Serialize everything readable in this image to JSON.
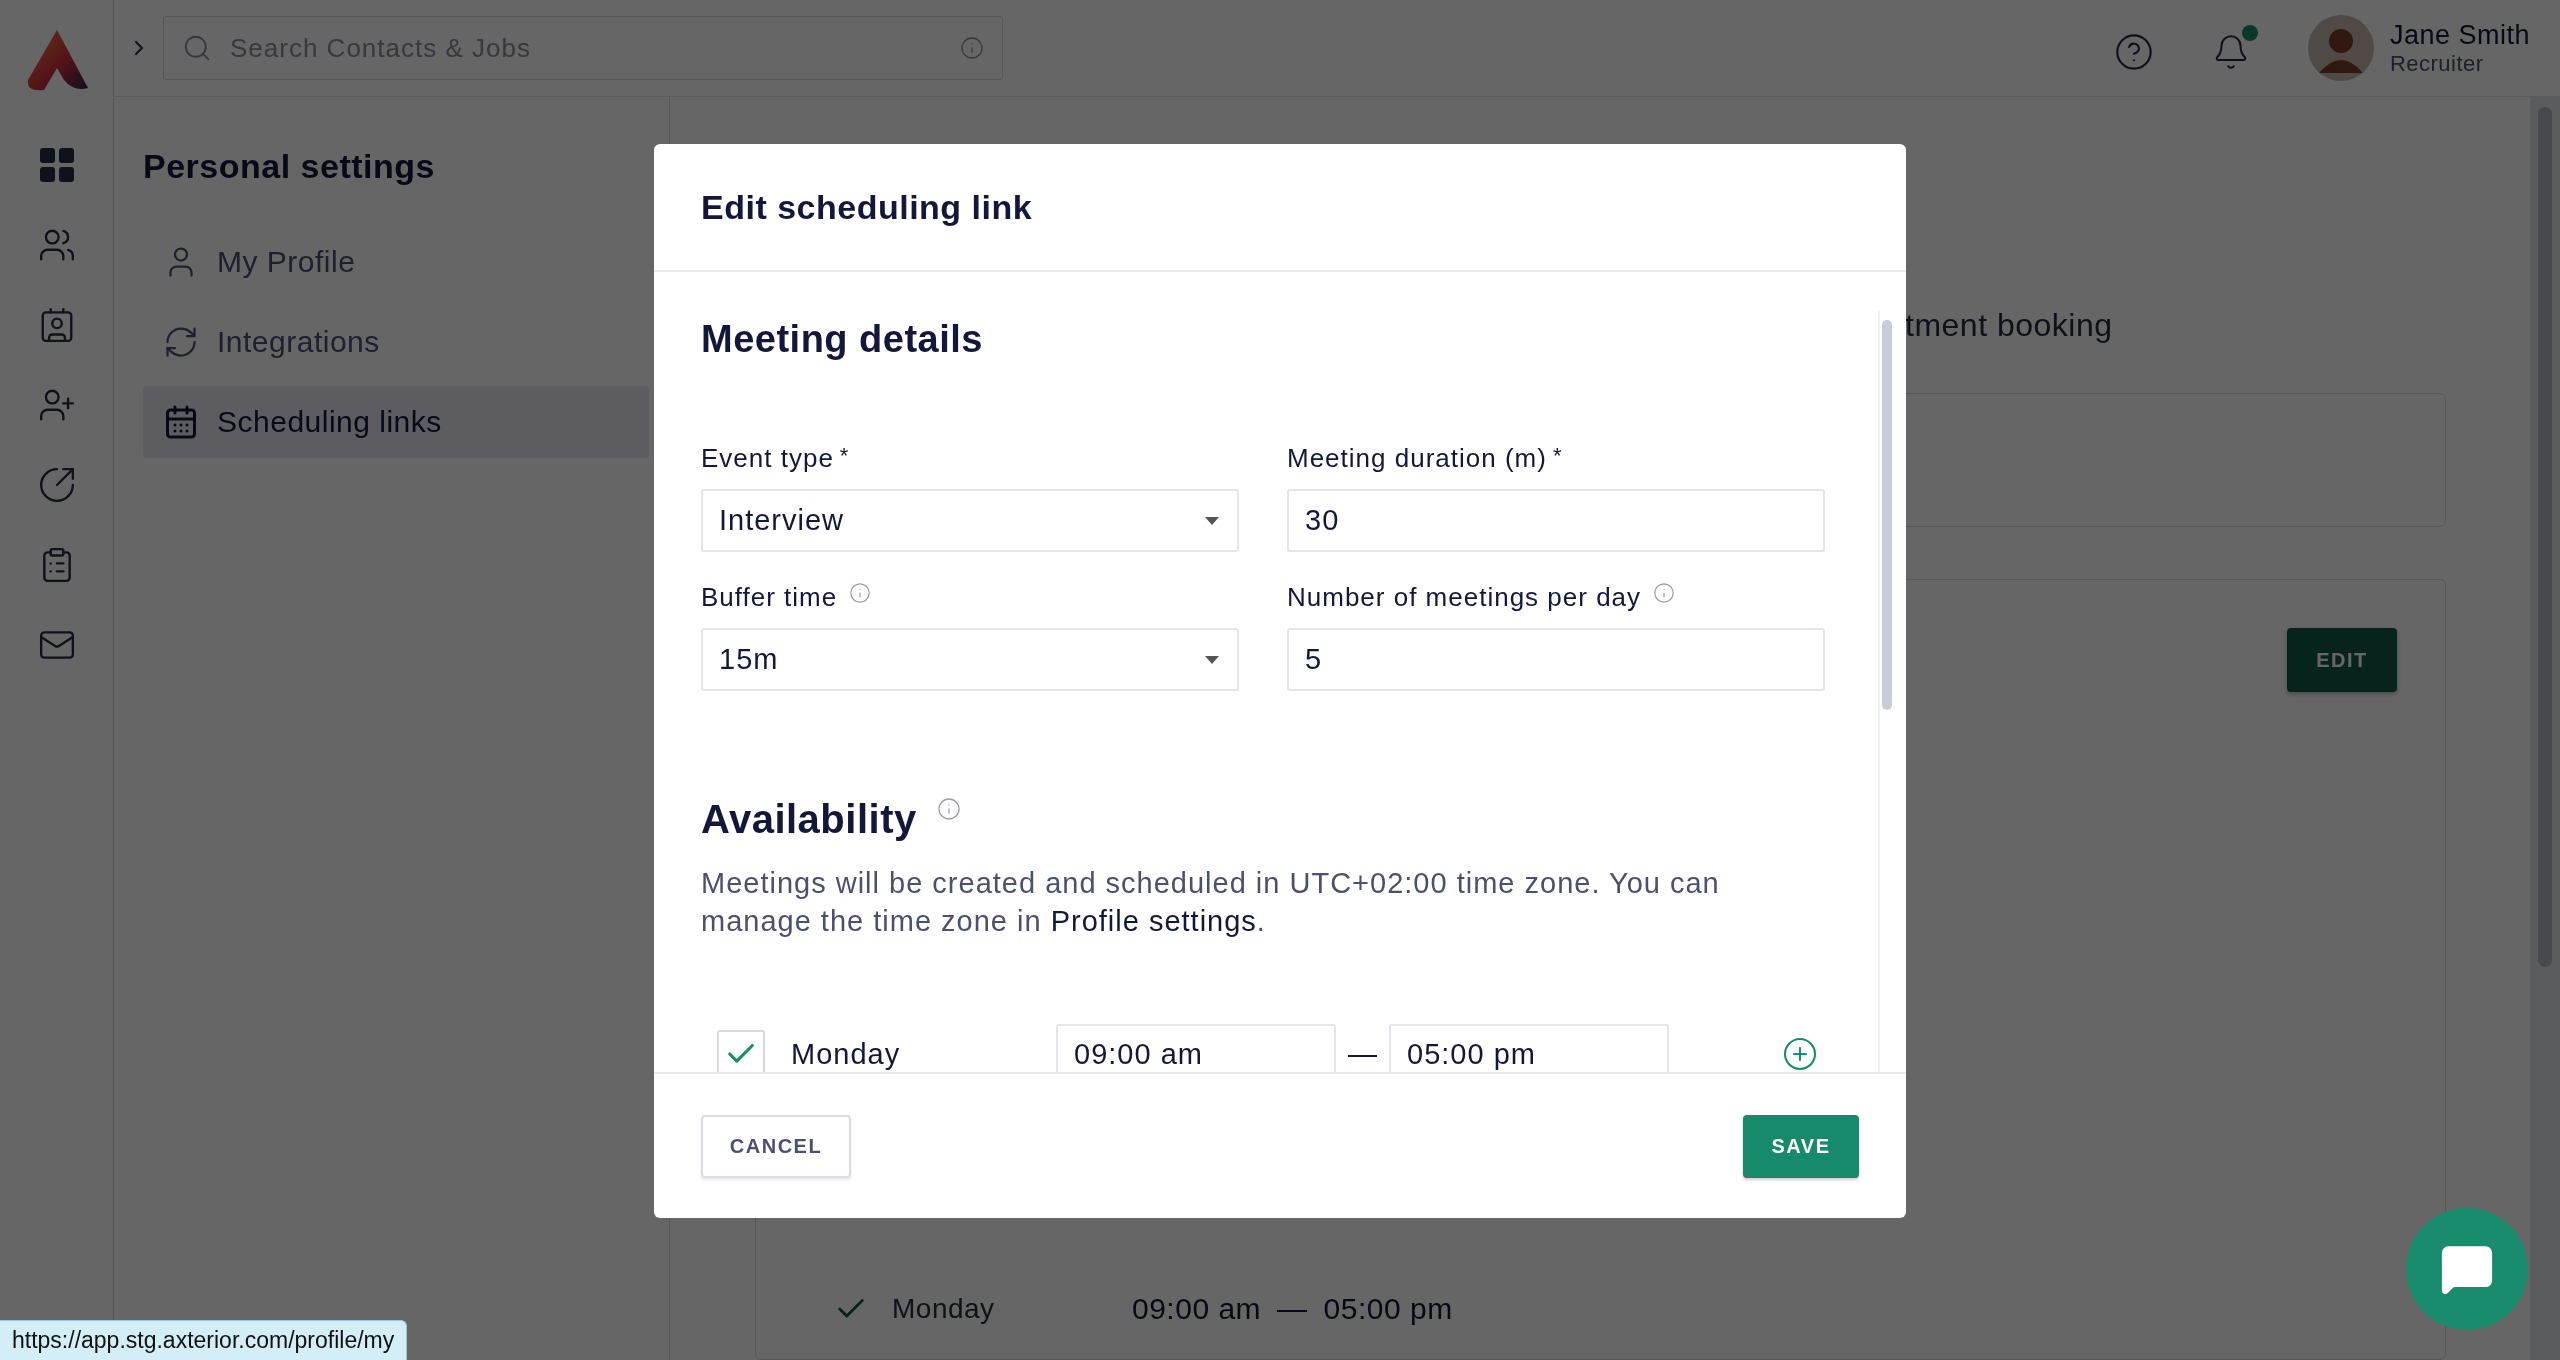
{
  "topbar": {
    "search": {
      "placeholder": "Search Contacts & Jobs"
    },
    "notifications": {
      "unread": true
    },
    "user": {
      "name": "Jane Smith",
      "role": "Recruiter"
    }
  },
  "rail": [
    {
      "kind": "grid"
    },
    {
      "kind": "people"
    },
    {
      "kind": "badge"
    },
    {
      "kind": "add-user"
    },
    {
      "kind": "arrow"
    },
    {
      "kind": "report"
    },
    {
      "kind": "mail"
    }
  ],
  "settings": {
    "title": "Personal settings",
    "items": [
      {
        "label": "My Profile",
        "kind": "person",
        "selected": false
      },
      {
        "label": "Integrations",
        "kind": "sync",
        "selected": false
      },
      {
        "label": "Scheduling links",
        "kind": "calendar",
        "selected": true
      }
    ]
  },
  "page": {
    "heading": "tment booking",
    "edit_button": "EDIT",
    "days": [
      {
        "day": "Monday",
        "checked": true,
        "from": "09:00 am",
        "separator": "—",
        "to": "05:00 pm"
      }
    ]
  },
  "modal": {
    "title": "Edit scheduling link",
    "meeting_details": {
      "heading": "Meeting details",
      "fields": [
        {
          "label": "Event type",
          "required_mark": "*",
          "info": false,
          "kind": "select",
          "value": "Interview"
        },
        {
          "label": "Meeting duration (m)",
          "required_mark": "*",
          "info": false,
          "kind": "text",
          "value": "30"
        },
        {
          "label": "Buffer time",
          "info": true,
          "kind": "select",
          "value": "15m"
        },
        {
          "label": "Number of meetings per day",
          "info": true,
          "kind": "text",
          "value": "5"
        }
      ]
    },
    "availability": {
      "heading": "Availability",
      "info": true,
      "note_before": "Meetings will be created and scheduled in UTC+02:00 time zone. You can manage the time zone in ",
      "link": "Profile settings",
      "note_after": ".",
      "days": [
        {
          "day": "Monday",
          "checked": true,
          "from": "09:00 am",
          "separator": "—",
          "to": "05:00 pm"
        }
      ]
    },
    "cancel": "CANCEL",
    "save": "SAVE"
  },
  "status_url": "https://app.stg.axterior.com/profile/my"
}
